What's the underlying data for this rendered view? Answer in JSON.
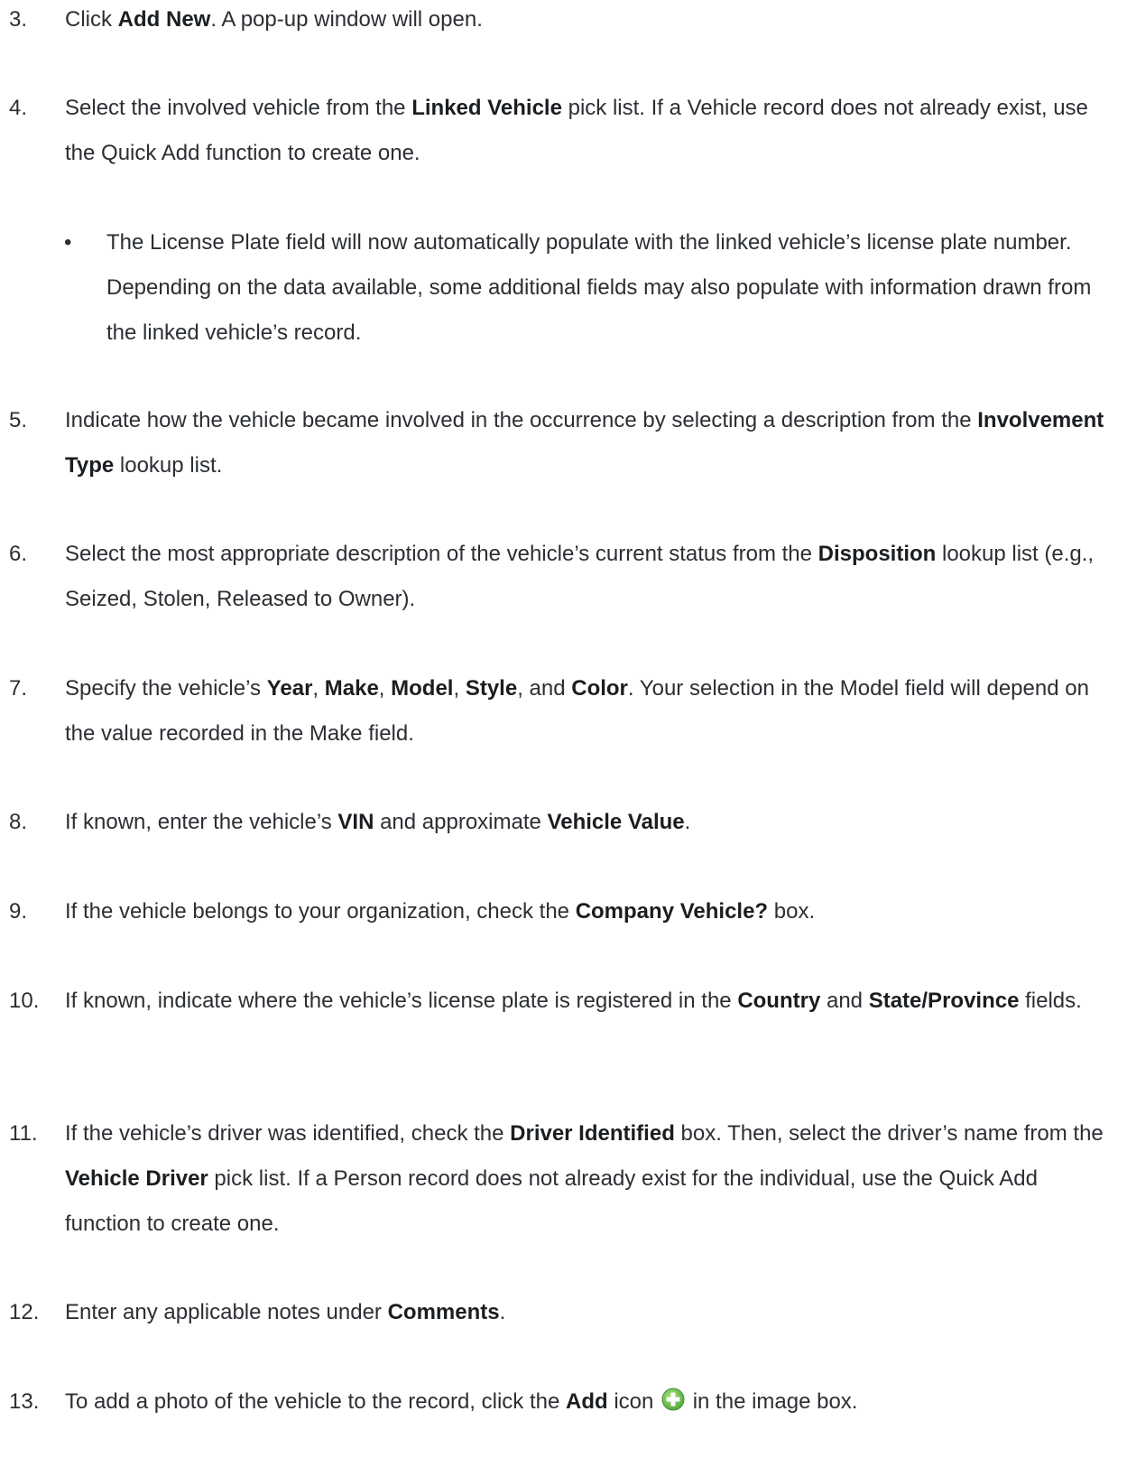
{
  "steps": [
    {
      "num": "3.",
      "parts": [
        {
          "t": "Click "
        },
        {
          "t": "Add New",
          "b": true
        },
        {
          "t": ". A pop-up window will open."
        }
      ]
    },
    {
      "num": "4.",
      "parts": [
        {
          "t": "Select the involved vehicle from the "
        },
        {
          "t": "Linked Vehicle",
          "b": true
        },
        {
          "t": " pick list. If a Vehicle record does not already exist, use the Quick Add function to create one."
        }
      ]
    },
    {
      "bullet": true,
      "parts": [
        {
          "t": "The License Plate field will now automatically populate with the linked vehicle’s license plate number. Depending on the data available, some additional fields may also populate with information drawn from the linked vehicle’s record."
        }
      ]
    },
    {
      "num": "5.",
      "parts": [
        {
          "t": "Indicate how the vehicle became involved in the occurrence by selecting a description from the "
        },
        {
          "t": "Involvement Type",
          "b": true
        },
        {
          "t": " lookup list."
        }
      ]
    },
    {
      "num": "6.",
      "parts": [
        {
          "t": "Select the most appropriate description of the vehicle’s current status from the "
        },
        {
          "t": "Disposition",
          "b": true
        },
        {
          "t": " lookup list (e.g., Seized, Stolen, Released to Owner)."
        }
      ]
    },
    {
      "num": "7.",
      "parts": [
        {
          "t": "Specify the vehicle’s "
        },
        {
          "t": "Year",
          "b": true
        },
        {
          "t": ", "
        },
        {
          "t": "Make",
          "b": true
        },
        {
          "t": ", "
        },
        {
          "t": "Model",
          "b": true
        },
        {
          "t": ", "
        },
        {
          "t": "Style",
          "b": true
        },
        {
          "t": ", and "
        },
        {
          "t": "Color",
          "b": true
        },
        {
          "t": ". Your selection in the Model field will depend on the value recorded in the Make field."
        }
      ]
    },
    {
      "num": "8.",
      "parts": [
        {
          "t": "If known, enter the vehicle’s "
        },
        {
          "t": "VIN",
          "b": true
        },
        {
          "t": " and approximate "
        },
        {
          "t": "Vehicle Value",
          "b": true
        },
        {
          "t": "."
        }
      ]
    },
    {
      "num": "9.",
      "parts": [
        {
          "t": "If the vehicle belongs to your organization, check the "
        },
        {
          "t": "Company Vehicle?",
          "b": true
        },
        {
          "t": " box."
        }
      ]
    },
    {
      "num": "10.",
      "parts": [
        {
          "t": "If known, indicate where the vehicle’s license plate is registered in the "
        },
        {
          "t": "Country",
          "b": true
        },
        {
          "t": " and "
        },
        {
          "t": "State/Province",
          "b": true
        },
        {
          "t": " fields."
        }
      ]
    },
    {
      "num": "11.",
      "parts": [
        {
          "t": "If the vehicle’s driver was identified, check the "
        },
        {
          "t": "Driver Identified",
          "b": true
        },
        {
          "t": " box. Then, select the driver’s name from the "
        },
        {
          "t": "Vehicle Driver",
          "b": true
        },
        {
          "t": " pick list. If a Person record does not already exist for the individual, use the Quick Add function to create one."
        }
      ]
    },
    {
      "num": "12.",
      "parts": [
        {
          "t": "Enter any applicable notes under "
        },
        {
          "t": "Comments",
          "b": true
        },
        {
          "t": "."
        }
      ]
    },
    {
      "num": "13.",
      "parts": [
        {
          "t": "To add a photo of the vehicle to the record, click the "
        },
        {
          "t": "Add",
          "b": true
        },
        {
          "t": " icon "
        },
        {
          "icon": "add-icon"
        },
        {
          "t": " in the image box."
        }
      ]
    }
  ],
  "colors": {
    "text": "#2b2f33",
    "bold_text": "#1b1e21",
    "add_icon_green": "#6cc04a"
  }
}
